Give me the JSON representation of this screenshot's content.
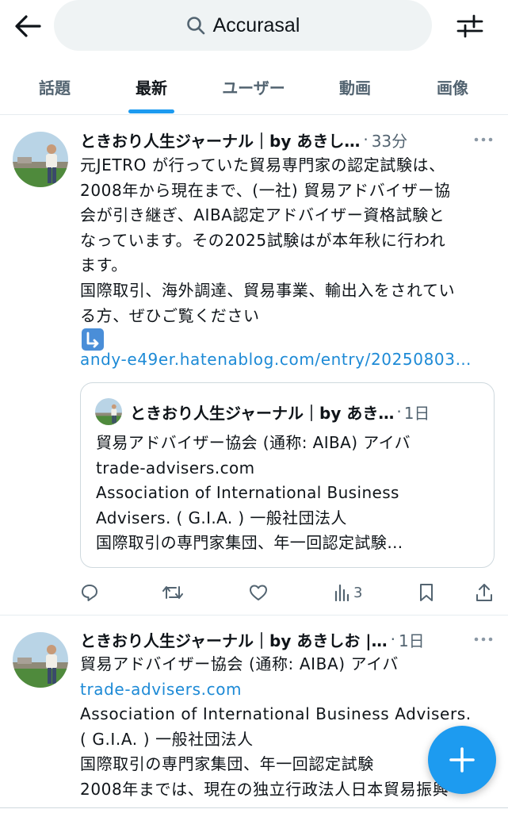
{
  "search": {
    "query": "Accurasal"
  },
  "tabs": [
    {
      "label": "話題"
    },
    {
      "label": "最新"
    },
    {
      "label": "ユーザー"
    },
    {
      "label": "動画"
    },
    {
      "label": "画像"
    }
  ],
  "active_tab": "最新",
  "post1": {
    "author": "ときおり人生ジャーナル｜by あきし…",
    "separator": "·",
    "time": "33分",
    "lines": [
      "元JETRO が行っていた貿易専門家の認定試験は、",
      "2008年から現在まで、(一社) 貿易アドバイザー協",
      "会が引き継ぎ、AIBA認定アドバイザー資格試験と",
      "なっています。その2025試験はが本年秋に行われ",
      "ます。",
      "国際取引、海外調達、貿易事業、輸出入をされてい",
      "る方、ぜひご覧ください"
    ],
    "link": "andy-e49er.hatenablog.com/entry/20250803…",
    "quote": {
      "author": "ときおり人生ジャーナル｜by あき…",
      "separator": "·",
      "time": "1日",
      "lines": [
        "貿易アドバイザー協会 (通称: AIBA) アイバ",
        "trade-advisers.com",
        "Association of International Business",
        "Advisers. ( G.I.A. ) 一般社団法人",
        "国際取引の専門家集団、年一回認定試験…"
      ]
    },
    "actions": {
      "views": "3"
    }
  },
  "post2": {
    "author": "ときおり人生ジャーナル｜by あきしお |…",
    "separator": "·",
    "time": "1日",
    "line1": "貿易アドバイザー協会 (通称: AIBA) アイバ",
    "link": "trade-advisers.com",
    "line3": "Association of International Business Advisers.",
    "line4": "( G.I.A. ) 一般社団法人",
    "line5": "国際取引の専門家集団、年一回認定試験",
    "line6": "2008年までは、現在の独立行政法人日本貿易振興"
  },
  "colors": {
    "accent": "#1d9bf0",
    "link": "#1d8ad6",
    "muted": "#536471",
    "text": "#0f1419"
  },
  "icons": {
    "back": "arrow-left-icon",
    "search": "search-icon",
    "filter": "sliders-icon",
    "more": "more-dots-icon",
    "reply": "reply-icon",
    "retweet": "retweet-icon",
    "like": "heart-icon",
    "views": "bar-chart-icon",
    "bookmark": "bookmark-icon",
    "share": "share-icon",
    "compose": "plus-icon"
  }
}
